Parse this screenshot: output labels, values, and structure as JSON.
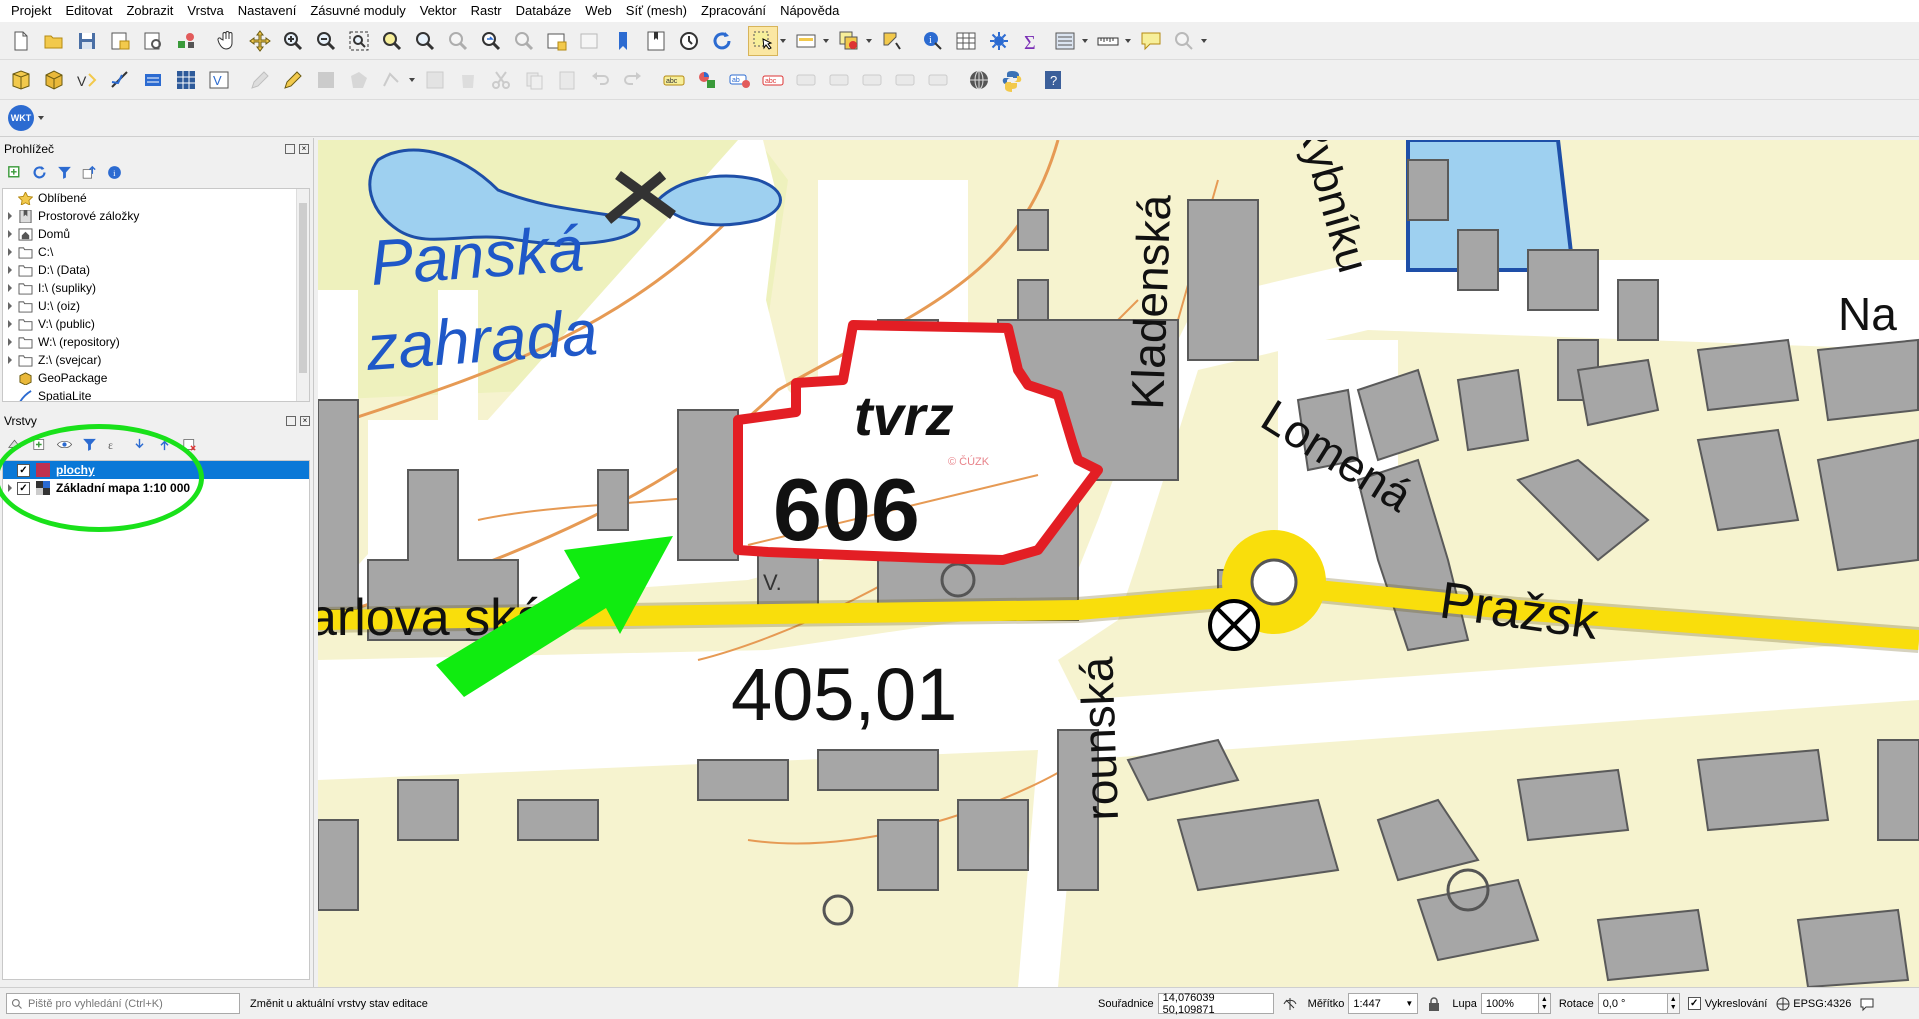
{
  "menu": [
    "Projekt",
    "Editovat",
    "Zobrazit",
    "Vrstva",
    "Nastavení",
    "Zásuvné moduly",
    "Vektor",
    "Rastr",
    "Databáze",
    "Web",
    "Síť (mesh)",
    "Zpracování",
    "Nápověda"
  ],
  "browser_panel": {
    "title": "Prohlížeč",
    "items": [
      {
        "label": "Oblíbené",
        "icon": "star-icon",
        "expand": false
      },
      {
        "label": "Prostorové záložky",
        "icon": "bookmark-icon",
        "expand": true
      },
      {
        "label": "Domů",
        "icon": "home-folder-icon",
        "expand": true
      },
      {
        "label": "C:\\",
        "icon": "folder-icon",
        "expand": true
      },
      {
        "label": "D:\\ (Data)",
        "icon": "folder-icon",
        "expand": true
      },
      {
        "label": "I:\\ (supliky)",
        "icon": "folder-icon",
        "expand": true
      },
      {
        "label": "U:\\ (oiz)",
        "icon": "folder-icon",
        "expand": true
      },
      {
        "label": "V:\\ (public)",
        "icon": "folder-icon",
        "expand": true
      },
      {
        "label": "W:\\ (repository)",
        "icon": "folder-icon",
        "expand": true
      },
      {
        "label": "Z:\\ (svejcar)",
        "icon": "folder-icon",
        "expand": true
      },
      {
        "label": "GeoPackage",
        "icon": "geopackage-icon",
        "expand": false
      },
      {
        "label": "SpatiaLite",
        "icon": "spatialite-icon",
        "expand": false
      }
    ]
  },
  "layers_panel": {
    "title": "Vrstvy",
    "layers": [
      {
        "name": "plochy",
        "checked": true,
        "selected": true,
        "symbol_color": "#c0314f"
      },
      {
        "name": "Základní mapa 1:10 000",
        "checked": true,
        "selected": false,
        "symbol_color": "#333333"
      }
    ]
  },
  "map": {
    "labels": {
      "area_name_1": "Panská",
      "area_name_2": "zahrada",
      "parcel_type": "tvrz",
      "parcel_number": "606",
      "elevation": "405,01",
      "street_kladenska": "Kladenská",
      "street_lomena": "Lomená",
      "street_prazska": "Pražsk",
      "street_karlovarska": "arlova  ská",
      "street_rybniku": "Rybníku",
      "street_na": "Na",
      "street_rounska": "rounská",
      "copyright": "© ČÚZK",
      "memorial_mark": "V."
    },
    "colors": {
      "parcel_outline": "#e31e24",
      "arrow": "#10ec10",
      "road": "#f9de0c",
      "building": "#a6a6a6",
      "water": "#9ed0f0"
    }
  },
  "statusbar": {
    "locator_placeholder": "Piště pro vyhledání (Ctrl+K)",
    "message": "Změnit u aktuální vrstvy stav editace",
    "coord_label": "Souřadnice",
    "coord_value": "14,076039 50,109871",
    "scale_label": "Měřítko",
    "scale_value": "1:447",
    "magnifier_label": "Lupa",
    "magnifier_value": "100%",
    "rotation_label": "Rotace",
    "rotation_value": "0,0 °",
    "render_label": "Vykreslování",
    "crs": "EPSG:4326"
  }
}
